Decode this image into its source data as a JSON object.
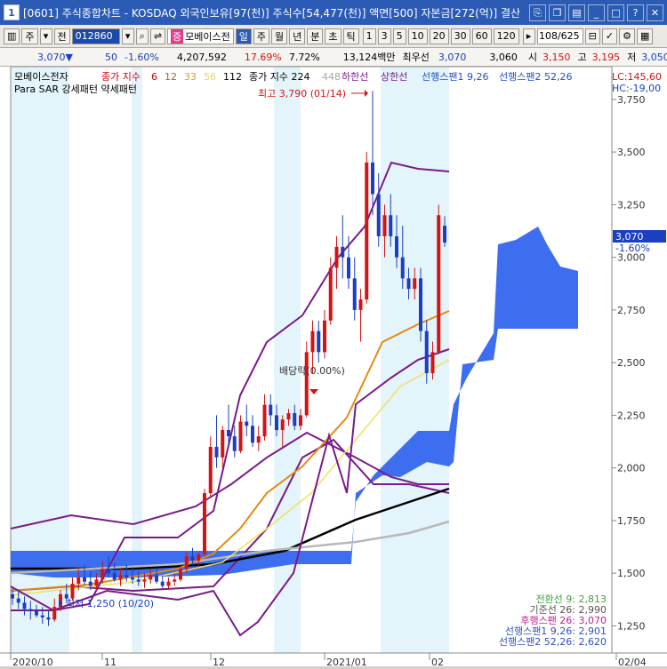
{
  "window": {
    "number": "1",
    "title": "[0601] 주식종합차트 - KOSDAQ 외국인보유[97(천)] 주식수[54,477(천)] 액면[500] 자본금[272(억)] 결산"
  },
  "toolbar": {
    "type_label": "주",
    "mode_label": "전",
    "stock_code": "012860",
    "stock_badge": "증",
    "stock_name": "모베이스전",
    "periods": [
      "일",
      "주",
      "월",
      "년",
      "분",
      "초",
      "틱"
    ],
    "selected_period": "일",
    "ranges": [
      "1",
      "3",
      "5",
      "10",
      "20",
      "30",
      "60",
      "120"
    ],
    "count": "108/625"
  },
  "quote": {
    "price": "3,070",
    "change": "50",
    "change_pct": "-1.60%",
    "volume": "4,207,592",
    "volume_ratio": "17.69%",
    "turnover": "7.72%",
    "amount": "13,124백만",
    "pref_label": "최우선",
    "pref_value": "3,070",
    "pref_value2": "3,060",
    "open_label": "시",
    "open": "3,150",
    "high_label": "고",
    "high": "3,195",
    "low_label": "저",
    "low": "3,050"
  },
  "legend": {
    "stock": "모베이스전자",
    "ma_label": "종가 지수",
    "ma_periods": [
      "6",
      "12",
      "33",
      "56",
      "112"
    ],
    "ma_colors": [
      "#cc0000",
      "#c06020",
      "#e0a000",
      "#e8d860",
      "#000000"
    ],
    "ma2_label": "종가 지수 224",
    "ma2_extra": "448",
    "bb_low": "하한선",
    "bb_high": "상한선",
    "span1": "선행스팬1 9,26",
    "span2": "선행스팬2 52,26",
    "para": "Para SAR 강세패턴  약세패턴",
    "lc": "LC:145,60",
    "hc": "HC:-19,00"
  },
  "annotations": {
    "max": "최고 3,790 (01/14)",
    "min": "최저 1,250 (10/20)",
    "dividend": "배당락(0.00%)"
  },
  "current_tag": {
    "price": "3,070",
    "pct": "-1.60%"
  },
  "ichimoku_values": [
    {
      "label": "전환선 9: 2,813",
      "color": "#40a040"
    },
    {
      "label": "기준선 26: 2,990",
      "color": "#555555"
    },
    {
      "label": "후행스팬 26: 3,070",
      "color": "#c02090"
    },
    {
      "label": "선행스팬1 9,26: 2,901",
      "color": "#3050c0"
    },
    {
      "label": "선행스팬2 52,26: 2,620",
      "color": "#3050c0"
    }
  ],
  "colors": {
    "up": "#d21414",
    "down": "#1b3fbf",
    "cloud": "#3366ee",
    "bollinger": "#7a1a8a",
    "highlight": "#e4f4fb"
  },
  "chart_data": {
    "type": "candlestick",
    "ylim": [
      1100,
      3800
    ],
    "yticks": [
      1250,
      1500,
      1750,
      2000,
      2250,
      2500,
      2750,
      3000,
      3250,
      3500,
      3750
    ],
    "xlabels": [
      "2020/10",
      "11",
      "12",
      "2021/01",
      "02",
      "02/04"
    ],
    "candles_ohlc": [
      [
        1400,
        1430,
        1350,
        1380
      ],
      [
        1380,
        1420,
        1330,
        1360
      ],
      [
        1360,
        1390,
        1300,
        1330
      ],
      [
        1330,
        1370,
        1280,
        1320
      ],
      [
        1320,
        1350,
        1290,
        1300
      ],
      [
        1300,
        1340,
        1260,
        1290
      ],
      [
        1290,
        1320,
        1250,
        1280
      ],
      [
        1280,
        1380,
        1270,
        1340
      ],
      [
        1340,
        1420,
        1320,
        1400
      ],
      [
        1400,
        1450,
        1360,
        1380
      ],
      [
        1380,
        1480,
        1370,
        1450
      ],
      [
        1450,
        1520,
        1420,
        1480
      ],
      [
        1480,
        1540,
        1440,
        1460
      ],
      [
        1460,
        1510,
        1420,
        1440
      ],
      [
        1440,
        1500,
        1420,
        1470
      ],
      [
        1470,
        1560,
        1450,
        1520
      ],
      [
        1520,
        1580,
        1480,
        1500
      ],
      [
        1500,
        1550,
        1460,
        1470
      ],
      [
        1470,
        1520,
        1440,
        1490
      ],
      [
        1490,
        1540,
        1460,
        1480
      ],
      [
        1480,
        1530,
        1450,
        1470
      ],
      [
        1470,
        1510,
        1440,
        1460
      ],
      [
        1460,
        1500,
        1430,
        1470
      ],
      [
        1470,
        1520,
        1450,
        1490
      ],
      [
        1490,
        1520,
        1450,
        1460
      ],
      [
        1460,
        1490,
        1430,
        1440
      ],
      [
        1440,
        1480,
        1420,
        1460
      ],
      [
        1460,
        1500,
        1440,
        1470
      ],
      [
        1470,
        1540,
        1460,
        1520
      ],
      [
        1520,
        1600,
        1500,
        1580
      ],
      [
        1580,
        1620,
        1540,
        1560
      ],
      [
        1560,
        1600,
        1530,
        1590
      ],
      [
        1590,
        1900,
        1580,
        1880
      ],
      [
        1880,
        2150,
        1860,
        2100
      ],
      [
        2100,
        2250,
        2000,
        2050
      ],
      [
        2050,
        2200,
        2000,
        2180
      ],
      [
        2180,
        2300,
        2100,
        2150
      ],
      [
        2150,
        2200,
        2050,
        2080
      ],
      [
        2080,
        2250,
        2070,
        2220
      ],
      [
        2220,
        2300,
        2150,
        2200
      ],
      [
        2200,
        2250,
        2100,
        2120
      ],
      [
        2120,
        2200,
        2080,
        2150
      ],
      [
        2150,
        2350,
        2130,
        2300
      ],
      [
        2300,
        2350,
        2200,
        2250
      ],
      [
        2250,
        2300,
        2150,
        2180
      ],
      [
        2180,
        2250,
        2100,
        2230
      ],
      [
        2230,
        2280,
        2200,
        2260
      ],
      [
        2260,
        2300,
        2180,
        2200
      ],
      [
        2200,
        2280,
        2180,
        2250
      ],
      [
        2250,
        2600,
        2240,
        2550
      ],
      [
        2550,
        2700,
        2450,
        2650
      ],
      [
        2650,
        2700,
        2500,
        2550
      ],
      [
        2550,
        2750,
        2520,
        2700
      ],
      [
        2700,
        3000,
        2680,
        2950
      ],
      [
        2950,
        3100,
        2850,
        3050
      ],
      [
        3050,
        3200,
        2900,
        3000
      ],
      [
        3000,
        3100,
        2850,
        2900
      ],
      [
        2900,
        3000,
        2700,
        2750
      ],
      [
        2750,
        2850,
        2600,
        2800
      ],
      [
        2800,
        3500,
        2780,
        3450
      ],
      [
        3450,
        3790,
        3200,
        3300
      ],
      [
        3300,
        3400,
        3050,
        3100
      ],
      [
        3100,
        3250,
        3000,
        3200
      ],
      [
        3200,
        3300,
        3050,
        3100
      ],
      [
        3100,
        3200,
        2950,
        3000
      ],
      [
        3000,
        3150,
        2850,
        2900
      ],
      [
        2900,
        2950,
        2800,
        2850
      ],
      [
        2850,
        2950,
        2800,
        2900
      ],
      [
        2900,
        2950,
        2600,
        2650
      ],
      [
        2650,
        2700,
        2400,
        2450
      ],
      [
        2450,
        2600,
        2420,
        2550
      ],
      [
        2550,
        3250,
        2540,
        3200
      ],
      [
        3150,
        3195,
        3050,
        3070
      ]
    ]
  }
}
